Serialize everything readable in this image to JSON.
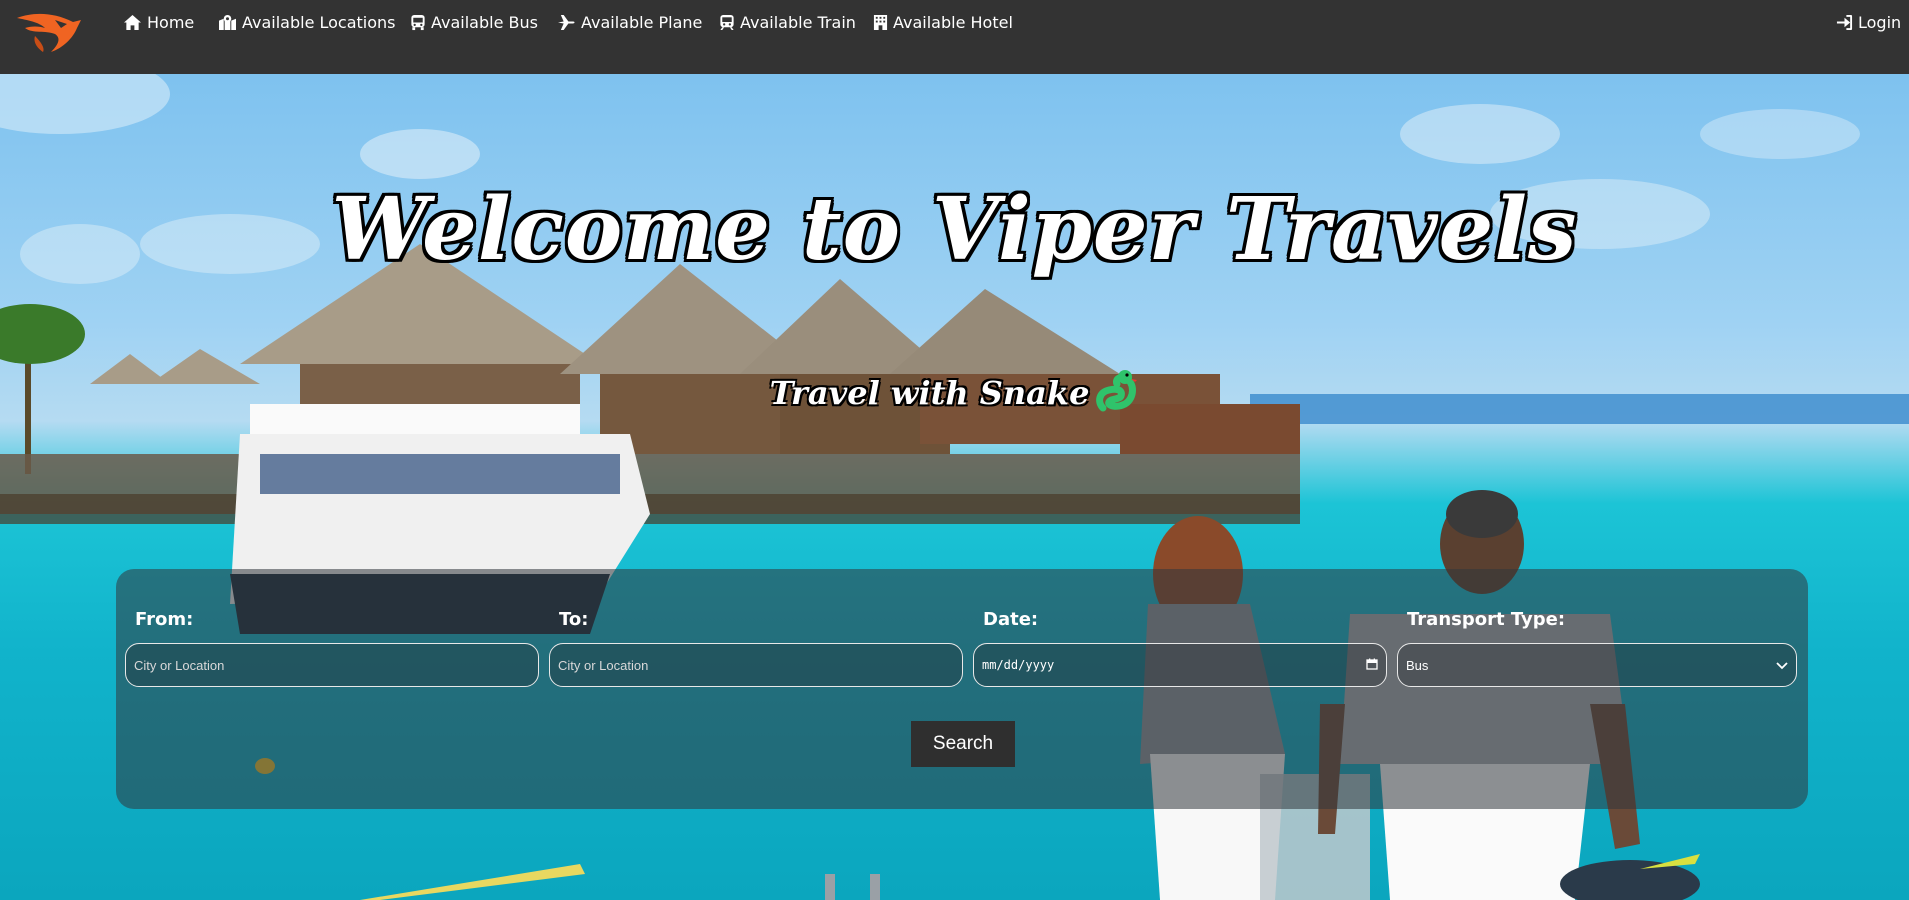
{
  "nav": {
    "home": "Home",
    "locations": "Available Locations",
    "bus": "Available Bus",
    "plane": "Available Plane",
    "train": "Available Train",
    "hotel": "Available Hotel",
    "login": "Login"
  },
  "hero": {
    "title": "Welcome to Viper Travels",
    "tagline": "Travel with Snake"
  },
  "search": {
    "from_label": "From:",
    "from_placeholder": "City or Location",
    "to_label": "To:",
    "to_placeholder": "City or Location",
    "date_label": "Date:",
    "date_placeholder": "mm/dd/yyyy",
    "transport_label": "Transport Type:",
    "transport_selected": "Bus",
    "button": "Search"
  },
  "colors": {
    "navbar": "#333333",
    "logo": "#f06422",
    "snake": "#2fc36b",
    "button": "#2f2f2f"
  },
  "icons": {
    "logo": "viper-logo",
    "home": "home-icon",
    "locations": "map-marked-icon",
    "bus": "bus-icon",
    "plane": "plane-icon",
    "train": "train-icon",
    "hotel": "hotel-icon",
    "login": "sign-in-icon",
    "snake": "snake-emoji-icon",
    "calendar": "calendar-icon",
    "chevron": "chevron-down-icon"
  }
}
